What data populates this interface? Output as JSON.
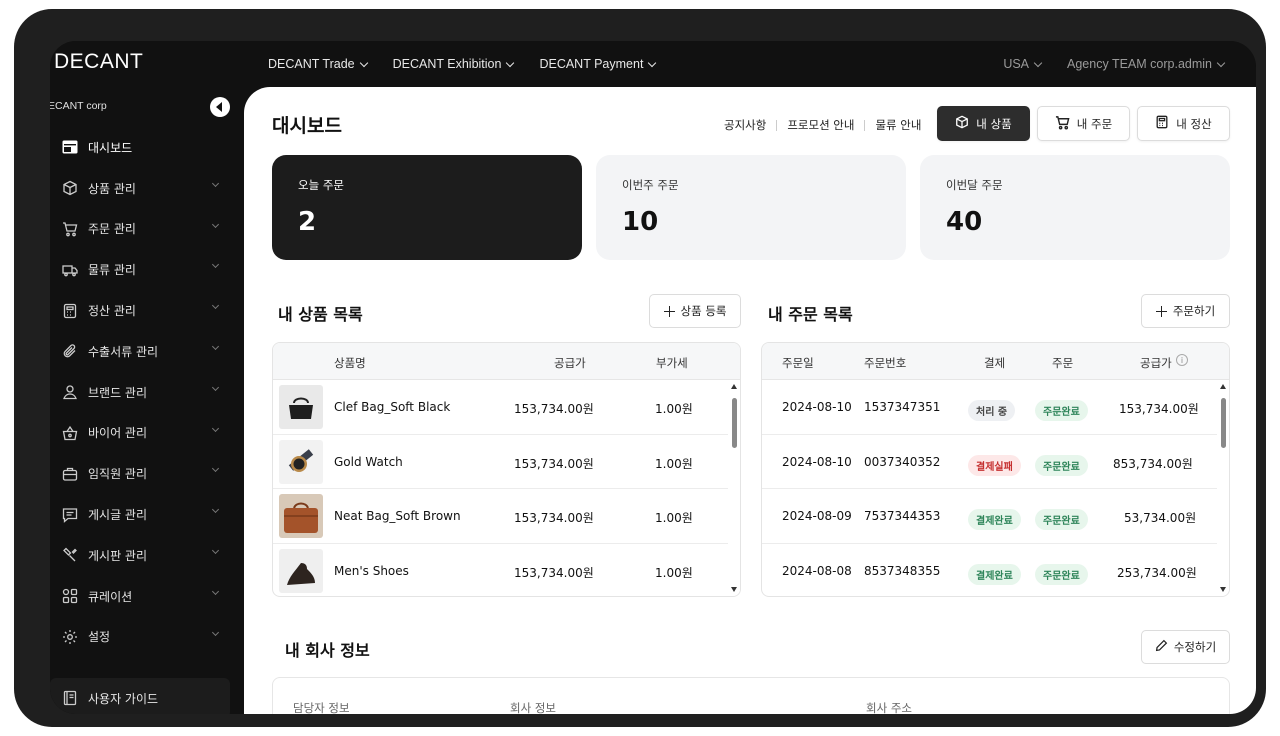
{
  "app": {
    "logo": "DECANT"
  },
  "topnav": {
    "items": [
      {
        "label": "DECANT Trade"
      },
      {
        "label": "DECANT Exhibition"
      },
      {
        "label": "DECANT Payment"
      }
    ],
    "region": "USA",
    "account": "Agency TEAM corp.admin"
  },
  "sidebar": {
    "corp": "ECANT corp",
    "items": [
      {
        "label": "대시보드",
        "icon": "dashboard-icon"
      },
      {
        "label": "상품 관리",
        "icon": "box-icon"
      },
      {
        "label": "주문 관리",
        "icon": "cart-icon"
      },
      {
        "label": "물류 관리",
        "icon": "truck-icon"
      },
      {
        "label": "정산 관리",
        "icon": "calculator-icon"
      },
      {
        "label": "수출서류 관리",
        "icon": "paperclip-icon"
      },
      {
        "label": "브랜드 관리",
        "icon": "user-icon"
      },
      {
        "label": "바이어 관리",
        "icon": "basket-icon"
      },
      {
        "label": "임직원 관리",
        "icon": "briefcase-icon"
      },
      {
        "label": "게시글 관리",
        "icon": "message-icon"
      },
      {
        "label": "게시판 관리",
        "icon": "tools-icon"
      },
      {
        "label": "큐레이션",
        "icon": "grid-icon"
      },
      {
        "label": "설정",
        "icon": "gear-icon"
      }
    ],
    "guide": "사용자 가이드"
  },
  "header": {
    "title": "대시보드",
    "links": [
      "공지사항",
      "프로모션 안내",
      "물류 안내"
    ],
    "buttons": {
      "products": "내 상품",
      "orders": "내 주문",
      "settlement": "내 정산"
    }
  },
  "stats": [
    {
      "label": "오늘 주문",
      "value": "2"
    },
    {
      "label": "이번주 주문",
      "value": "10"
    },
    {
      "label": "이번달 주문",
      "value": "40"
    }
  ],
  "products": {
    "title": "내 상품 목록",
    "add_button": "상품 등록",
    "columns": [
      "상품명",
      "공급가",
      "부가세"
    ],
    "rows": [
      {
        "name": "Clef Bag_Soft Black",
        "price": "153,734.00원",
        "tax": "1.00원"
      },
      {
        "name": "Gold Watch",
        "price": "153,734.00원",
        "tax": "1.00원"
      },
      {
        "name": "Neat Bag_Soft Brown",
        "price": "153,734.00원",
        "tax": "1.00원"
      },
      {
        "name": "Men's Shoes",
        "price": "153,734.00원",
        "tax": "1.00원"
      }
    ]
  },
  "orders": {
    "title": "내 주문 목록",
    "add_button": "주문하기",
    "columns": [
      "주문일",
      "주문번호",
      "결제",
      "주문",
      "공급가"
    ],
    "rows": [
      {
        "date": "2024-08-10",
        "number": "1537347351",
        "payment": "처리 중",
        "order": "주문완료",
        "price": "153,734.00원"
      },
      {
        "date": "2024-08-10",
        "number": "0037340352",
        "payment": "결제실패",
        "order": "주문완료",
        "price": "853,734.00원"
      },
      {
        "date": "2024-08-09",
        "number": "7537344353",
        "payment": "결제완료",
        "order": "주문완료",
        "price": "53,734.00원"
      },
      {
        "date": "2024-08-08",
        "number": "8537348355",
        "payment": "결제완료",
        "order": "주문완료",
        "price": "253,734.00원"
      }
    ]
  },
  "company": {
    "title": "내 회사 정보",
    "edit_button": "수정하기",
    "columns": [
      "담당자 정보",
      "회사 정보",
      "회사 주소"
    ]
  }
}
